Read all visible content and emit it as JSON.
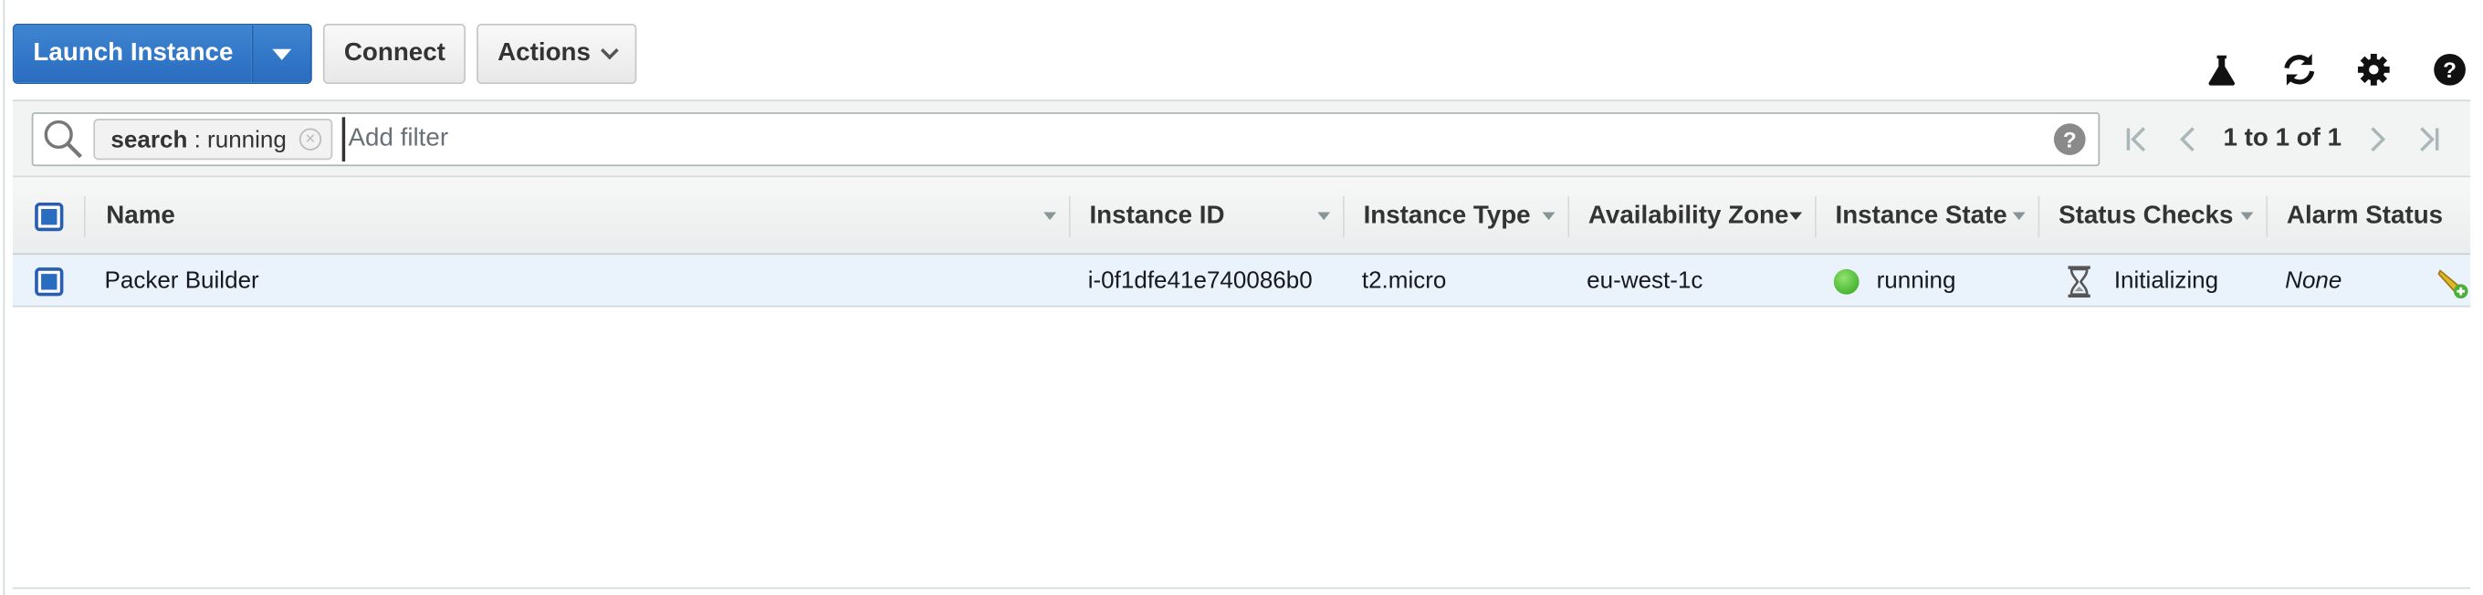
{
  "toolbar": {
    "launch_label": "Launch Instance",
    "connect_label": "Connect",
    "actions_label": "Actions"
  },
  "tool_icons": [
    "flask-icon",
    "refresh-icon",
    "gear-icon",
    "help-icon"
  ],
  "filter": {
    "token_key": "search",
    "token_sep": " : ",
    "token_value": "running",
    "placeholder": "Add filter"
  },
  "pager": {
    "text": "1 to 1 of 1"
  },
  "columns": {
    "name": "Name",
    "instance_id": "Instance ID",
    "instance_type": "Instance Type",
    "availability_zone": "Availability Zone",
    "instance_state": "Instance State",
    "status_checks": "Status Checks",
    "alarm_status": "Alarm Status"
  },
  "rows": [
    {
      "name": "Packer Builder",
      "instance_id": "i-0f1dfe41e740086b0",
      "instance_type": "t2.micro",
      "availability_zone": "eu-west-1c",
      "instance_state": "running",
      "status_checks": "Initializing",
      "alarm_status": "None"
    }
  ],
  "colors": {
    "primary": "#2a6cc0",
    "running": "#2ea31a",
    "row_selected": "#eaf2fb"
  }
}
